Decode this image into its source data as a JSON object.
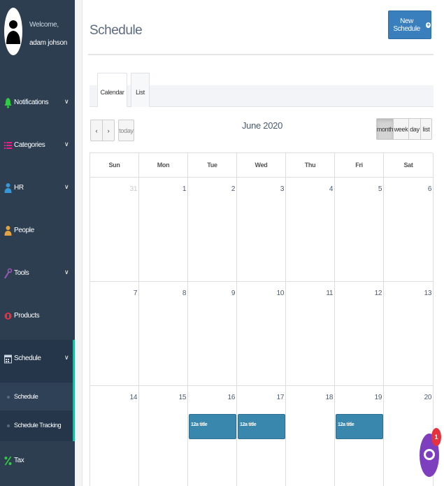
{
  "user": {
    "welcome": "Welcome,",
    "name": "adam johson"
  },
  "sidebar": {
    "items": [
      {
        "label": "Notifications",
        "icon": "bell-icon",
        "color": "#2ecc40",
        "has_chevron": true
      },
      {
        "label": "Categories",
        "icon": "list-icon",
        "color": "#e91e8c",
        "has_chevron": true
      },
      {
        "label": "HR",
        "icon": "user-icon",
        "color": "#3498db",
        "has_chevron": true
      },
      {
        "label": "People",
        "icon": "user-icon",
        "color": "#e6a23c",
        "has_chevron": false
      },
      {
        "label": "Tools",
        "icon": "wrench-icon",
        "color": "#9b59b6",
        "has_chevron": true
      },
      {
        "label": "Products",
        "icon": "product-icon",
        "color": "#e5323e",
        "has_chevron": false
      },
      {
        "label": "Schedule",
        "icon": "calendar-icon",
        "color": "#cfd8e3",
        "has_chevron": true
      },
      {
        "label": "Tax",
        "icon": "percent-icon",
        "color": "#2ecc40",
        "has_chevron": false
      }
    ],
    "chevron": "∨",
    "schedule_sub": [
      {
        "label": "Schedule",
        "active": true
      },
      {
        "label": "Schedule Tracking",
        "active": false
      }
    ]
  },
  "page": {
    "title": "Schedule",
    "new_button": "New Schedule",
    "new_button_icon": "plus-circle-icon"
  },
  "tabs": [
    {
      "label": "Calendar",
      "active": true
    },
    {
      "label": "List",
      "active": false
    }
  ],
  "calendar": {
    "prev": "‹",
    "next": "›",
    "today": "today",
    "title": "June 2020",
    "views": [
      {
        "label": "month",
        "active": true
      },
      {
        "label": "week",
        "active": false
      },
      {
        "label": "day",
        "active": false
      },
      {
        "label": "list",
        "active": false
      }
    ],
    "days_of_week": [
      "Sun",
      "Mon",
      "Tue",
      "Wed",
      "Thu",
      "Fri",
      "Sat"
    ],
    "weeks": [
      [
        "31",
        "1",
        "2",
        "3",
        "4",
        "5",
        "6"
      ],
      [
        "7",
        "8",
        "9",
        "10",
        "11",
        "12",
        "13"
      ],
      [
        "14",
        "15",
        "16",
        "17",
        "18",
        "19",
        "20"
      ]
    ],
    "other_month_days": [
      "31"
    ],
    "events": [
      {
        "label": "12a title",
        "week": 2,
        "day": 2
      },
      {
        "label": "12a title",
        "week": 2,
        "day": 3
      },
      {
        "label": "12a title",
        "week": 2,
        "day": 5
      }
    ]
  },
  "chat": {
    "badge": "1",
    "icon": "chat-bubble-icon",
    "color": "#7e3fbf"
  }
}
